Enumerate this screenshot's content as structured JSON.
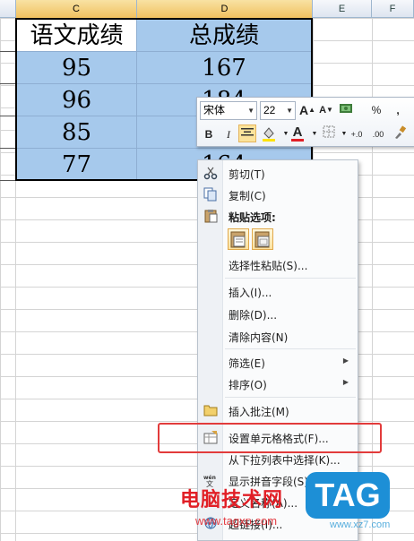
{
  "columns": [
    "C",
    "D",
    "E",
    "F"
  ],
  "table": {
    "headers": [
      "语文成绩",
      "总成绩"
    ],
    "rows": [
      [
        "95",
        "167"
      ],
      [
        "96",
        "184"
      ],
      [
        "85",
        ""
      ],
      [
        "77",
        "164"
      ]
    ]
  },
  "mini_toolbar": {
    "font_name": "宋体",
    "font_size": "22",
    "grow_font": "A",
    "shrink_font": "A",
    "percent": "%",
    "comma": ",",
    "bold": "B",
    "italic": "I",
    "font_color_letter": "A",
    "dec_increase": "+.0",
    "dec_decrease": ".00"
  },
  "context_menu": {
    "cut": "剪切(T)",
    "copy": "复制(C)",
    "paste_options": "粘贴选项:",
    "paste_special": "选择性粘贴(S)...",
    "insert": "插入(I)...",
    "delete": "删除(D)...",
    "clear_contents": "清除内容(N)",
    "filter": "筛选(E)",
    "sort": "排序(O)",
    "insert_comment": "插入批注(M)",
    "format_cells": "设置单元格格式(F)...",
    "pick_from_list": "从下拉列表中选择(K)...",
    "show_phonetic": "显示拼音字段(S)",
    "define_name": "定义名称(A)...",
    "hyperlink": "超链接(I)..."
  },
  "watermark": {
    "brand_text": "电脑技术网",
    "url": "www.tagxp.com",
    "tag": "TAG",
    "site": "www.xz7.com"
  },
  "colors": {
    "selection_fill": "#a6c9ec",
    "highlight": "#e23b3b",
    "watermark_red": "#e11f26",
    "tag_blue": "#1d8fd6"
  }
}
